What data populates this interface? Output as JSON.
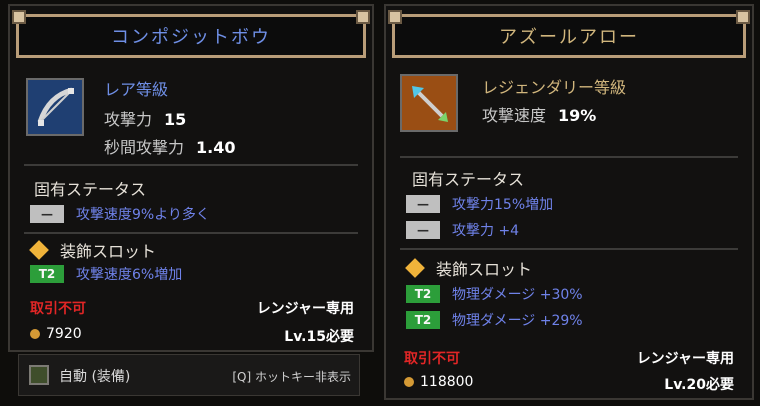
{
  "left_card": {
    "title": "コンポジットボウ",
    "rarity": "レア等級",
    "stats": [
      {
        "label": "攻撃力",
        "value": "15"
      },
      {
        "label": "秒間攻撃力",
        "value": "1.40"
      }
    ],
    "intrinsic_title": "固有ステータス",
    "intrinsic": [
      {
        "badge": "—",
        "text": "攻撃速度9%より多く"
      }
    ],
    "slot_title": "装飾スロット",
    "slot_rows": [
      {
        "badge": "T2",
        "text": "攻撃速度6%増加"
      }
    ],
    "trade": "取引不可",
    "class_only": "レンジャー専用",
    "price": "7920",
    "level_req": "Lv.15必要",
    "colors": {
      "rarity": "#6f8fe6",
      "title": "#6f8fe6"
    }
  },
  "right_card": {
    "title": "アズールアロー",
    "rarity": "レジェンダリー等級",
    "stats": [
      {
        "label": "攻撃速度",
        "value": "19%"
      }
    ],
    "intrinsic_title": "固有ステータス",
    "intrinsic": [
      {
        "badge": "—",
        "text": "攻撃力15%増加"
      },
      {
        "badge": "—",
        "text": "攻撃力 +4"
      }
    ],
    "slot_title": "装飾スロット",
    "slot_rows": [
      {
        "badge": "T2",
        "text": "物理ダメージ +30%"
      },
      {
        "badge": "T2",
        "text": "物理ダメージ +29%"
      }
    ],
    "trade": "取引不可",
    "class_only": "レンジャー専用",
    "price": "118800",
    "level_req": "Lv.20必要",
    "colors": {
      "rarity": "#d1b67d",
      "title": "#d1b67d"
    }
  },
  "bottom_bar": {
    "label": "自動 (装備)",
    "hint": "[Q] ホットキー非表示"
  }
}
